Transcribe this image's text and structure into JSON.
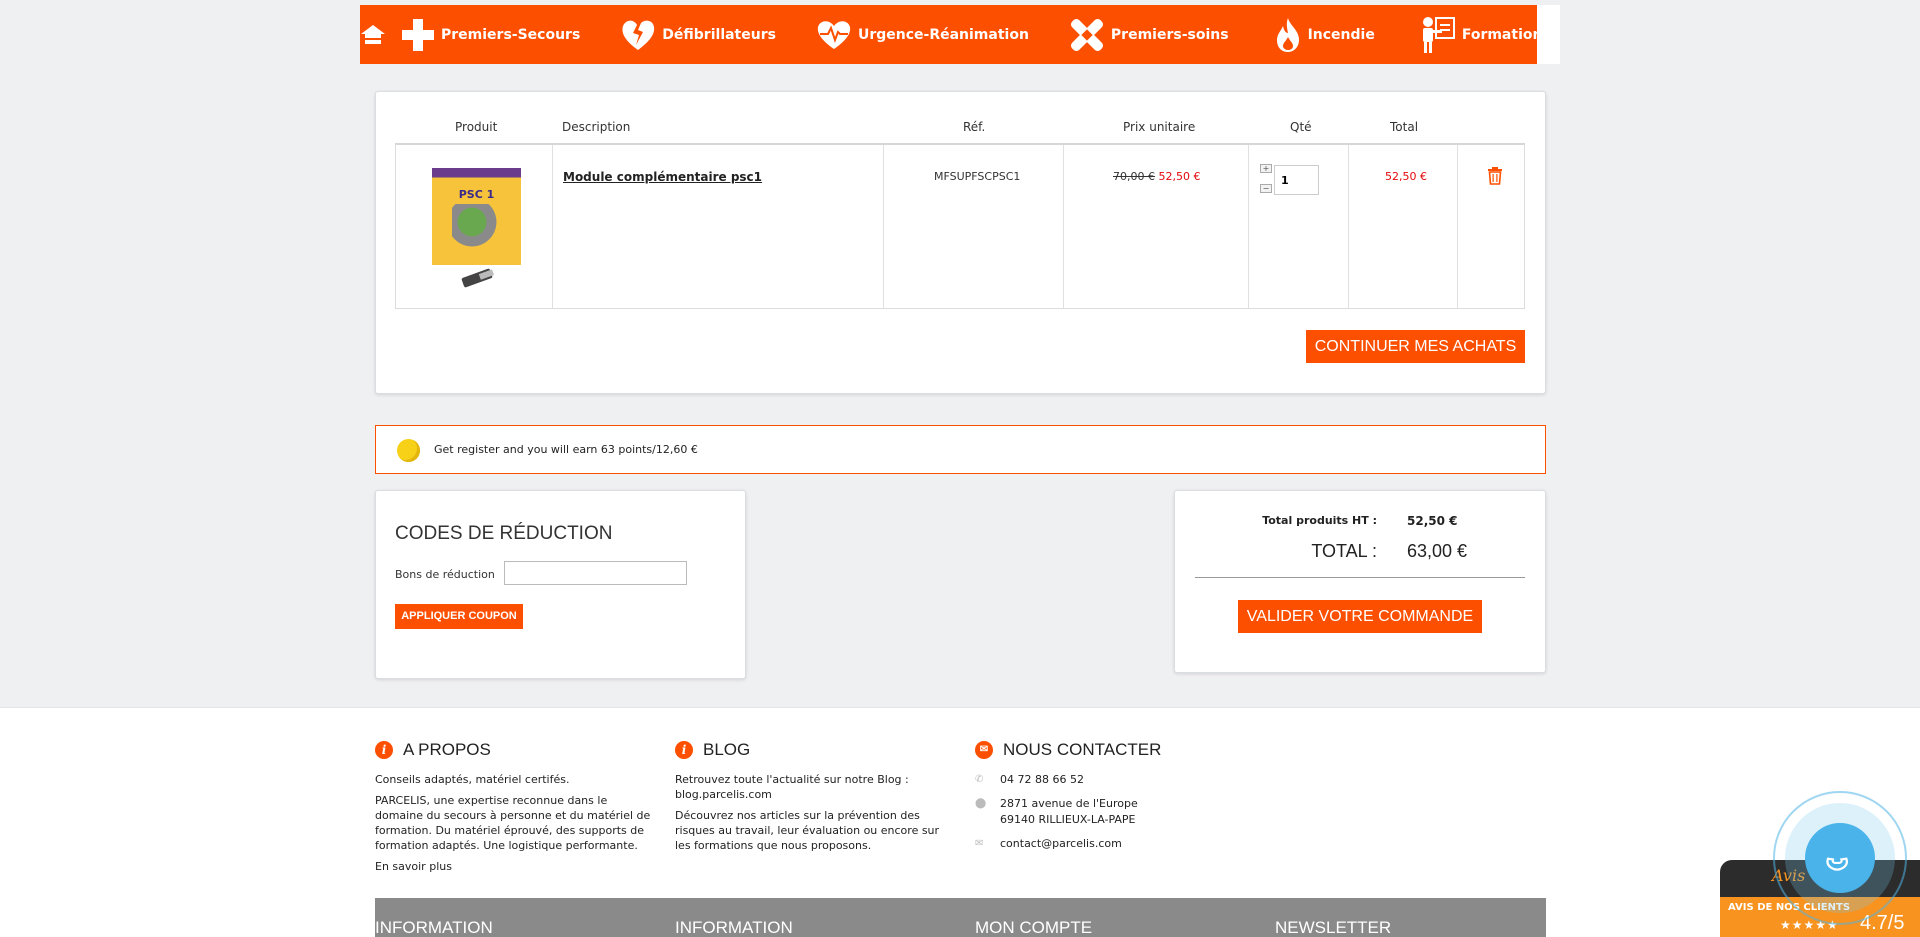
{
  "nav": {
    "items": [
      {
        "label": "Premiers-Secours",
        "icon": "cross-icon"
      },
      {
        "label": "Défibrillateurs",
        "icon": "broken-heart-icon"
      },
      {
        "label": "Urgence-Réanimation",
        "icon": "heartbeat-icon"
      },
      {
        "label": "Premiers-soins",
        "icon": "bandage-icon"
      },
      {
        "label": "Incendie",
        "icon": "flame-icon"
      },
      {
        "label": "Formation",
        "icon": "trainer-icon"
      }
    ]
  },
  "cart": {
    "headers": {
      "product": "Produit",
      "description": "Description",
      "ref": "Réf.",
      "unit_price": "Prix unitaire",
      "qty": "Qté",
      "total": "Total"
    },
    "item": {
      "image_label": "PSC 1",
      "name": "Module complémentaire psc1",
      "ref": "MFSUPFSCPSC1",
      "price_old": "70,00 €",
      "price_new": "52,50 €",
      "qty": "1",
      "qty_plus": "+",
      "qty_minus": "−",
      "total": "52,50 €"
    },
    "continue_label": "CONTINUER MES ACHATS"
  },
  "points": {
    "text": "Get register and you will earn 63 points/12,60 €"
  },
  "coupon": {
    "title": "CODES DE RÉDUCTION",
    "label": "Bons de réduction",
    "value": "",
    "button": "APPLIQUER COUPON"
  },
  "totals": {
    "products_label": "Total produits HT :",
    "products_value": "52,50 €",
    "total_label": "TOTAL :",
    "total_value": "63,00 €",
    "validate_label": "VALIDER VOTRE COMMANDE"
  },
  "footer": {
    "about": {
      "title": "A PROPOS",
      "p1": "Conseils adaptés, matériel certifés.",
      "p2": "PARCELIS, une expertise reconnue dans le domaine du secours à personne et du matériel de formation. Du matériel éprouvé, des supports de formation adaptés. Une logistique performante.",
      "link": "En savoir plus"
    },
    "blog": {
      "title": "BLOG",
      "p1": "Retrouvez toute l'actualité sur notre Blog : blog.parcelis.com",
      "p2": "Découvrez nos articles sur la prévention des risques au travail, leur évaluation ou encore sur les formations que nous proposons."
    },
    "contact": {
      "title": "NOUS CONTACTER",
      "phone": "04 72 88 66 52",
      "address1": "2871 avenue de l'Europe",
      "address2": "69140 RILLIEUX-LA-PAPE",
      "email": "contact@parcelis.com"
    },
    "bottom_titles": [
      "INFORMATION",
      "INFORMATION",
      "MON COMPTE",
      "NEWSLETTER"
    ]
  },
  "reviews": {
    "avis": "Avis",
    "label": "AVIS DE NOS CLIENTS",
    "stars": "★★★★★",
    "score": "4.7/5"
  },
  "colors": {
    "brand": "#fd4f00",
    "price_red": "#e3080c",
    "phone_blue": "#4ab3ea"
  }
}
